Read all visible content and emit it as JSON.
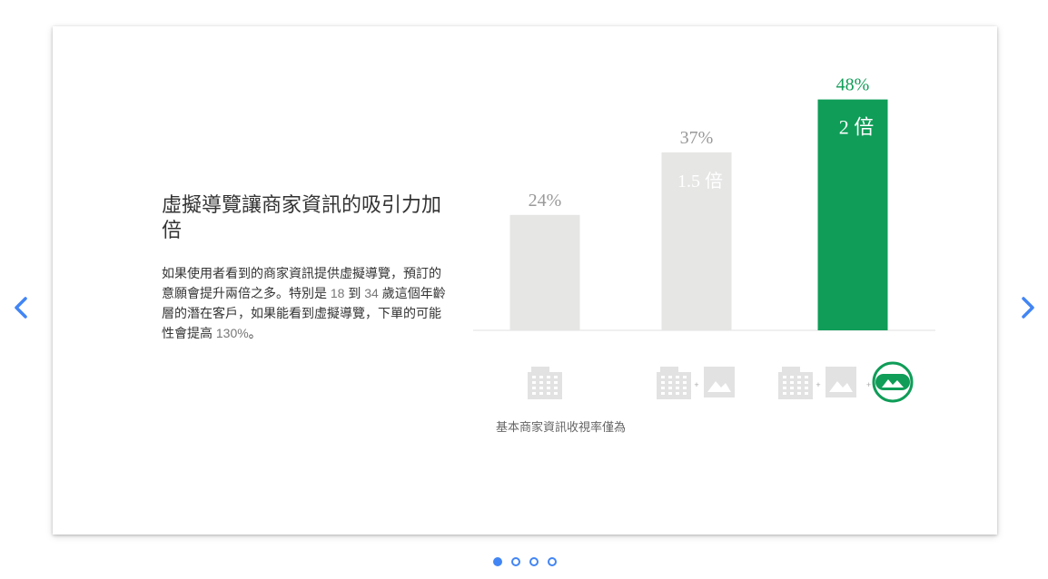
{
  "slide": {
    "headline": "虛擬導覽讓商家資訊的吸引力加倍",
    "body_parts": [
      "如果使用者看到的商家資訊提供虛擬導覽，預訂的意願會提升兩倍之多。特別是 ",
      "18",
      " 到 ",
      "34",
      " 歲這個年齡層的潛在客戶，如果能看到虛擬導覽，下單的可能性會提高 ",
      "130%",
      "。"
    ],
    "baseline_caption": "基本商家資訊收視率僅為"
  },
  "chart_data": {
    "type": "bar",
    "categories": [
      "商家資訊",
      "商家資訊 + 相片",
      "商家資訊 + 相片 + 虛擬導覽"
    ],
    "values": [
      24,
      37,
      48
    ],
    "value_labels": [
      "24%",
      "37%",
      "48%"
    ],
    "multiplier_labels": [
      "",
      "1.5 倍",
      "2 倍"
    ],
    "category_icons": [
      [
        "building-icon"
      ],
      [
        "building-icon",
        "photo-icon"
      ],
      [
        "building-icon",
        "photo-icon",
        "virtual-tour-icon"
      ]
    ],
    "icon_separator": "+",
    "ylim": [
      0,
      50
    ],
    "grid": false,
    "colors": {
      "neutral": "#e6e6e5",
      "highlight": "#0f9d58",
      "label_neutral": "#999999"
    }
  },
  "pagination": {
    "count": 4,
    "active": 0
  },
  "colors": {
    "accent": "#4285f4",
    "highlight": "#0f9d58"
  }
}
